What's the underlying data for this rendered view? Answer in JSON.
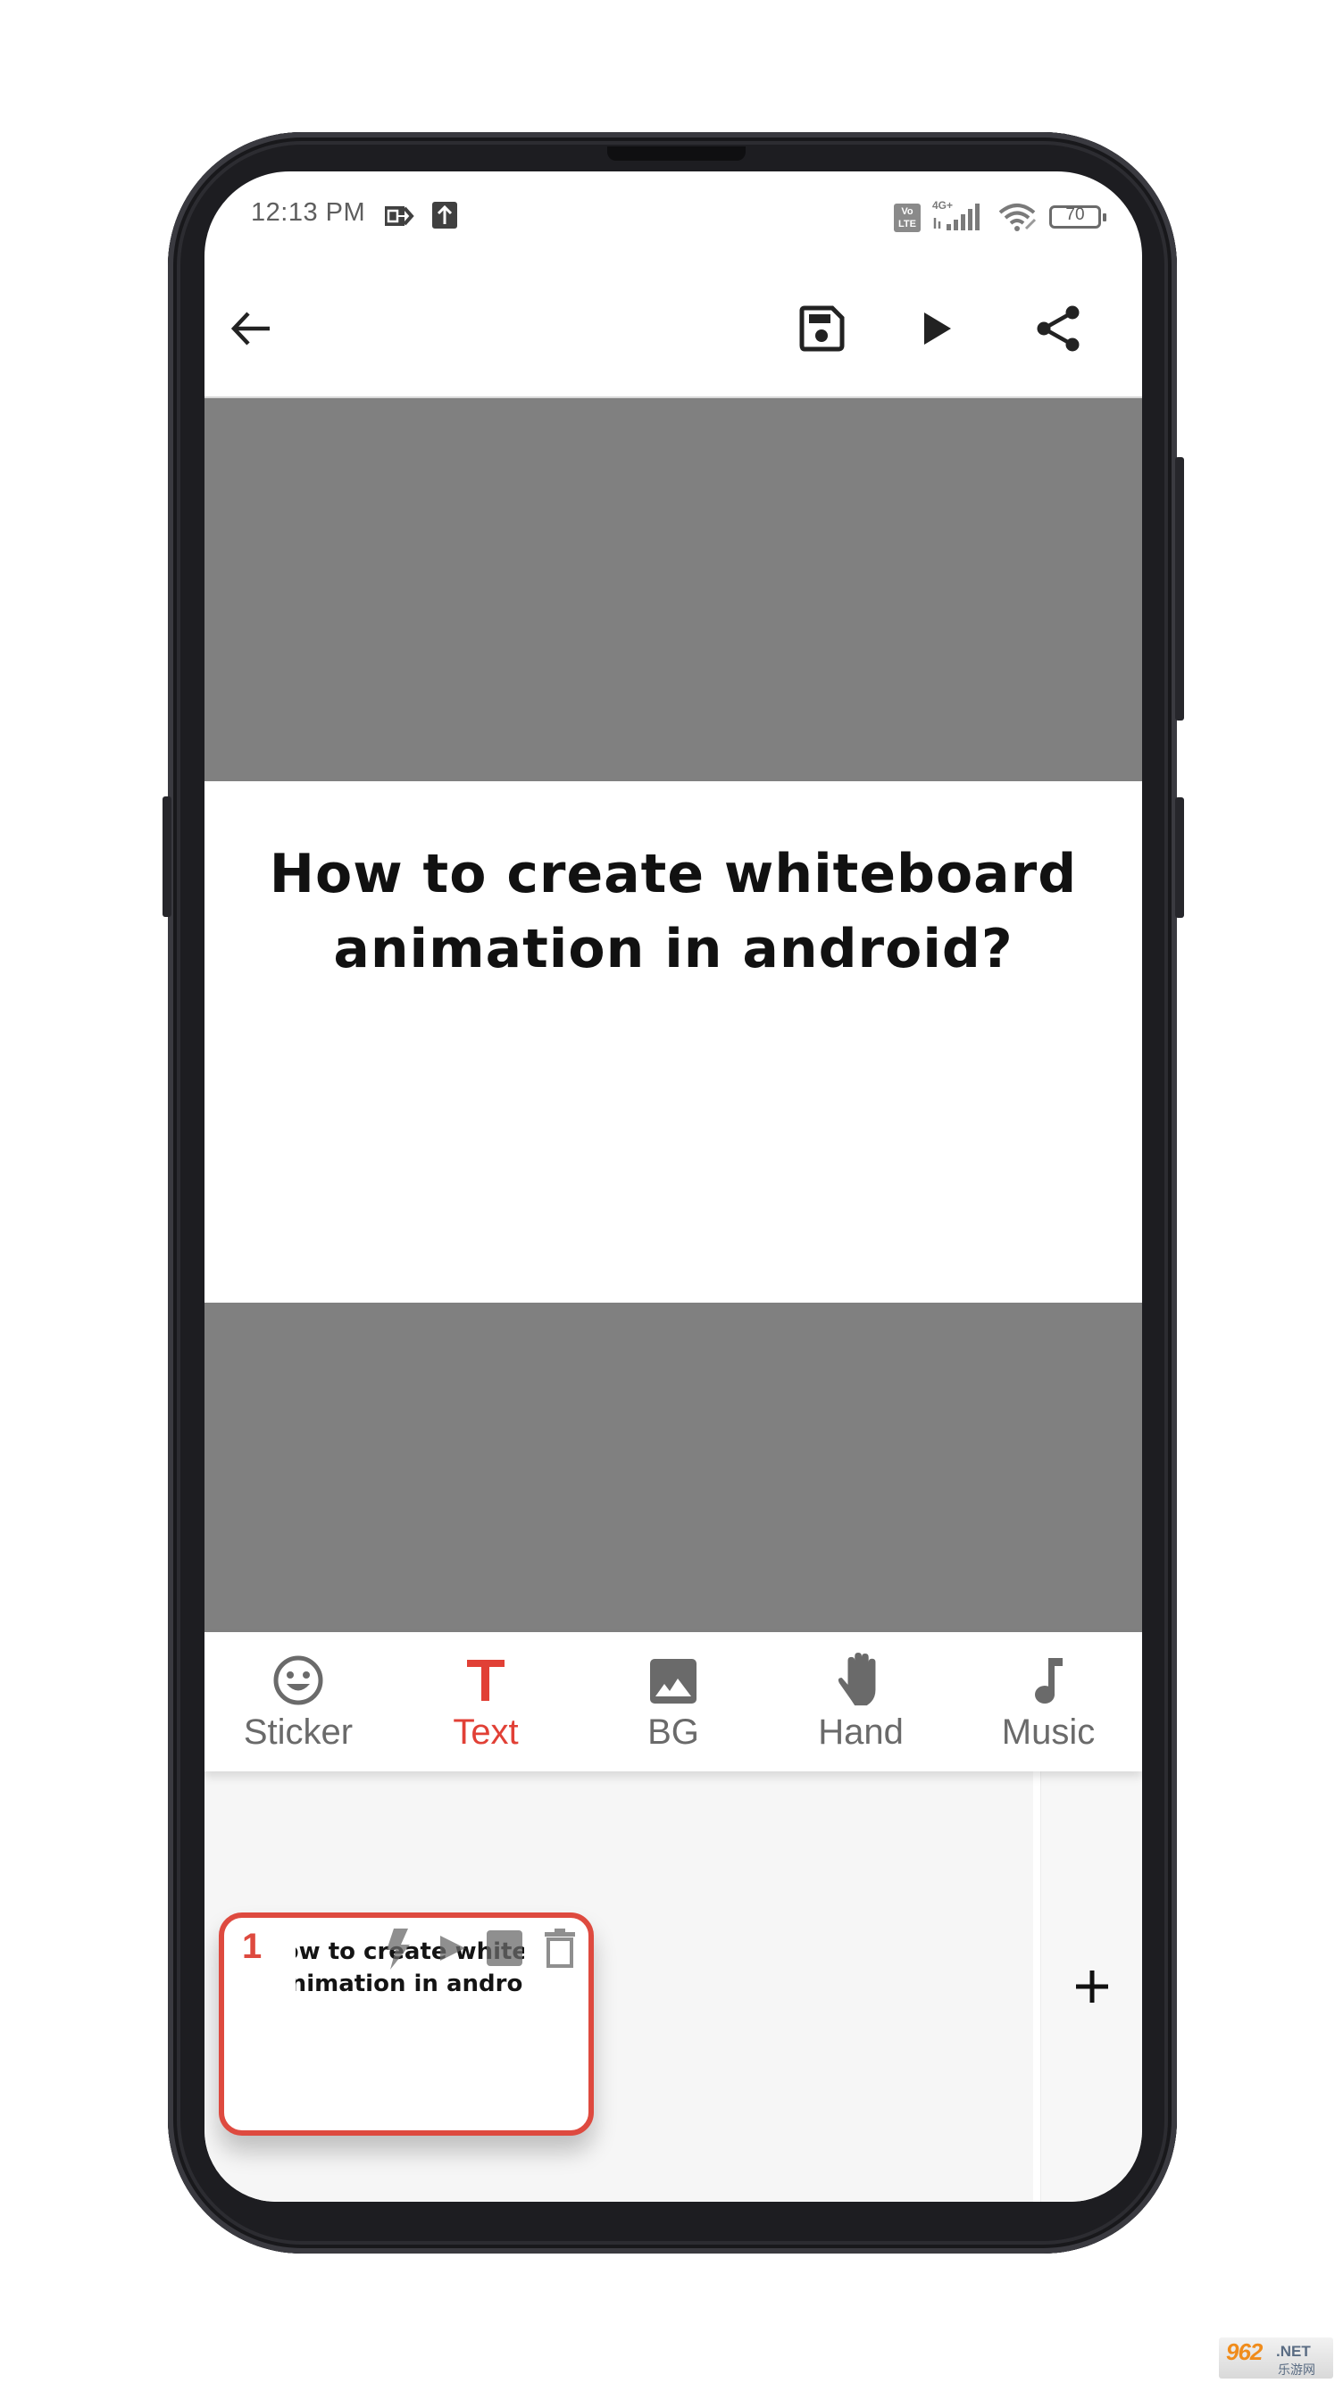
{
  "status_bar": {
    "time": "12:13 PM",
    "battery_level": "70",
    "network_label": "4G+",
    "volte_label": "Vo LTE",
    "icons": [
      "notification-app-icon",
      "upload-icon",
      "volte-icon",
      "signal-icon",
      "wifi-icon",
      "battery-icon"
    ]
  },
  "app_bar": {
    "back_icon": "arrow-left-icon",
    "actions": [
      {
        "name": "save",
        "icon": "floppy-disk-icon"
      },
      {
        "name": "play",
        "icon": "play-icon"
      },
      {
        "name": "share",
        "icon": "share-icon"
      }
    ]
  },
  "canvas": {
    "text_line1": "How to create whiteboard",
    "text_line2": "animation in android?",
    "letterbox_color": "#808080",
    "board_color": "#ffffff"
  },
  "tool_tabs": {
    "active": "Text",
    "accent_color": "#e14036",
    "items": [
      {
        "label": "Sticker",
        "icon": "smiley-icon"
      },
      {
        "label": "Text",
        "icon": "text-t-icon"
      },
      {
        "label": "BG",
        "icon": "image-icon"
      },
      {
        "label": "Hand",
        "icon": "hand-icon"
      },
      {
        "label": "Music",
        "icon": "music-note-icon"
      }
    ]
  },
  "scenes": {
    "items": [
      {
        "number": "1",
        "preview_line1": "How to create whiteboard",
        "preview_line2": "animation in android",
        "selected": true,
        "tools": [
          "lightning-icon",
          "play-icon",
          "image-icon",
          "trash-icon"
        ]
      }
    ],
    "add_label": "+"
  },
  "watermark": {
    "main": "962",
    "suffix": ".NET",
    "sub": "乐游网"
  }
}
